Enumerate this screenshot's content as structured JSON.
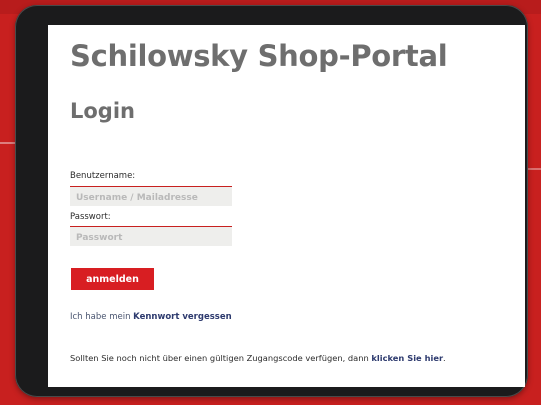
{
  "page": {
    "shop_title": "Schilowsky Shop-Portal",
    "heading": "Login"
  },
  "login_form": {
    "username_label": "Benutzername:",
    "username_placeholder": "Username / Mailadresse",
    "username_value": "",
    "password_label": "Passwort:",
    "password_placeholder": "Passwort",
    "password_value": "",
    "submit_label": "anmelden"
  },
  "forgot": {
    "prefix": "Ich habe mein ",
    "link_text": "Kennwort vergessen"
  },
  "register": {
    "prefix": "Sollten Sie noch nicht über einen gültigen Zugangscode verfügen, dann ",
    "link_text": "klicken Sie hier",
    "suffix": "."
  },
  "colors": {
    "background_red": "#c8201f",
    "button_red": "#d81e22",
    "title_gray": "#6e6e6e",
    "link_blue": "#2d3a6e",
    "device_frame": "#1b1b1c"
  }
}
